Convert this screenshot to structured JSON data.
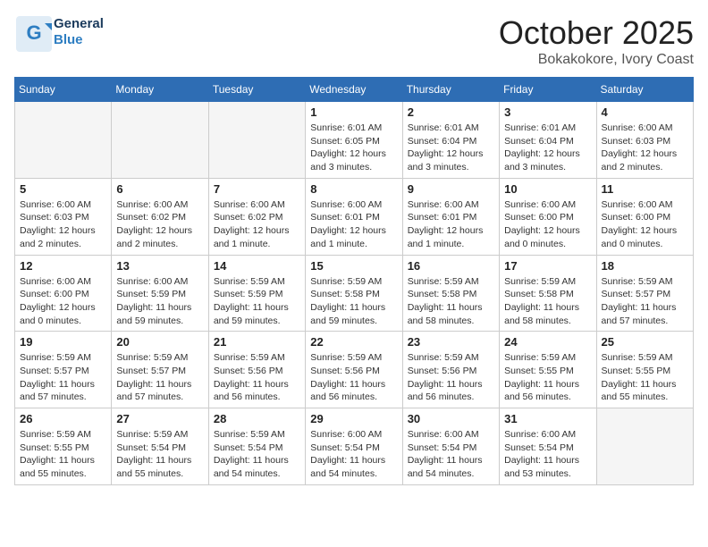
{
  "header": {
    "logo_general": "General",
    "logo_blue": "Blue",
    "title": "October 2025",
    "location": "Bokakokore, Ivory Coast"
  },
  "weekdays": [
    "Sunday",
    "Monday",
    "Tuesday",
    "Wednesday",
    "Thursday",
    "Friday",
    "Saturday"
  ],
  "weeks": [
    [
      {
        "num": "",
        "info": ""
      },
      {
        "num": "",
        "info": ""
      },
      {
        "num": "",
        "info": ""
      },
      {
        "num": "1",
        "info": "Sunrise: 6:01 AM\nSunset: 6:05 PM\nDaylight: 12 hours\nand 3 minutes."
      },
      {
        "num": "2",
        "info": "Sunrise: 6:01 AM\nSunset: 6:04 PM\nDaylight: 12 hours\nand 3 minutes."
      },
      {
        "num": "3",
        "info": "Sunrise: 6:01 AM\nSunset: 6:04 PM\nDaylight: 12 hours\nand 3 minutes."
      },
      {
        "num": "4",
        "info": "Sunrise: 6:00 AM\nSunset: 6:03 PM\nDaylight: 12 hours\nand 2 minutes."
      }
    ],
    [
      {
        "num": "5",
        "info": "Sunrise: 6:00 AM\nSunset: 6:03 PM\nDaylight: 12 hours\nand 2 minutes."
      },
      {
        "num": "6",
        "info": "Sunrise: 6:00 AM\nSunset: 6:02 PM\nDaylight: 12 hours\nand 2 minutes."
      },
      {
        "num": "7",
        "info": "Sunrise: 6:00 AM\nSunset: 6:02 PM\nDaylight: 12 hours\nand 1 minute."
      },
      {
        "num": "8",
        "info": "Sunrise: 6:00 AM\nSunset: 6:01 PM\nDaylight: 12 hours\nand 1 minute."
      },
      {
        "num": "9",
        "info": "Sunrise: 6:00 AM\nSunset: 6:01 PM\nDaylight: 12 hours\nand 1 minute."
      },
      {
        "num": "10",
        "info": "Sunrise: 6:00 AM\nSunset: 6:00 PM\nDaylight: 12 hours\nand 0 minutes."
      },
      {
        "num": "11",
        "info": "Sunrise: 6:00 AM\nSunset: 6:00 PM\nDaylight: 12 hours\nand 0 minutes."
      }
    ],
    [
      {
        "num": "12",
        "info": "Sunrise: 6:00 AM\nSunset: 6:00 PM\nDaylight: 12 hours\nand 0 minutes."
      },
      {
        "num": "13",
        "info": "Sunrise: 6:00 AM\nSunset: 5:59 PM\nDaylight: 11 hours\nand 59 minutes."
      },
      {
        "num": "14",
        "info": "Sunrise: 5:59 AM\nSunset: 5:59 PM\nDaylight: 11 hours\nand 59 minutes."
      },
      {
        "num": "15",
        "info": "Sunrise: 5:59 AM\nSunset: 5:58 PM\nDaylight: 11 hours\nand 59 minutes."
      },
      {
        "num": "16",
        "info": "Sunrise: 5:59 AM\nSunset: 5:58 PM\nDaylight: 11 hours\nand 58 minutes."
      },
      {
        "num": "17",
        "info": "Sunrise: 5:59 AM\nSunset: 5:58 PM\nDaylight: 11 hours\nand 58 minutes."
      },
      {
        "num": "18",
        "info": "Sunrise: 5:59 AM\nSunset: 5:57 PM\nDaylight: 11 hours\nand 57 minutes."
      }
    ],
    [
      {
        "num": "19",
        "info": "Sunrise: 5:59 AM\nSunset: 5:57 PM\nDaylight: 11 hours\nand 57 minutes."
      },
      {
        "num": "20",
        "info": "Sunrise: 5:59 AM\nSunset: 5:57 PM\nDaylight: 11 hours\nand 57 minutes."
      },
      {
        "num": "21",
        "info": "Sunrise: 5:59 AM\nSunset: 5:56 PM\nDaylight: 11 hours\nand 56 minutes."
      },
      {
        "num": "22",
        "info": "Sunrise: 5:59 AM\nSunset: 5:56 PM\nDaylight: 11 hours\nand 56 minutes."
      },
      {
        "num": "23",
        "info": "Sunrise: 5:59 AM\nSunset: 5:56 PM\nDaylight: 11 hours\nand 56 minutes."
      },
      {
        "num": "24",
        "info": "Sunrise: 5:59 AM\nSunset: 5:55 PM\nDaylight: 11 hours\nand 56 minutes."
      },
      {
        "num": "25",
        "info": "Sunrise: 5:59 AM\nSunset: 5:55 PM\nDaylight: 11 hours\nand 55 minutes."
      }
    ],
    [
      {
        "num": "26",
        "info": "Sunrise: 5:59 AM\nSunset: 5:55 PM\nDaylight: 11 hours\nand 55 minutes."
      },
      {
        "num": "27",
        "info": "Sunrise: 5:59 AM\nSunset: 5:54 PM\nDaylight: 11 hours\nand 55 minutes."
      },
      {
        "num": "28",
        "info": "Sunrise: 5:59 AM\nSunset: 5:54 PM\nDaylight: 11 hours\nand 54 minutes."
      },
      {
        "num": "29",
        "info": "Sunrise: 6:00 AM\nSunset: 5:54 PM\nDaylight: 11 hours\nand 54 minutes."
      },
      {
        "num": "30",
        "info": "Sunrise: 6:00 AM\nSunset: 5:54 PM\nDaylight: 11 hours\nand 54 minutes."
      },
      {
        "num": "31",
        "info": "Sunrise: 6:00 AM\nSunset: 5:54 PM\nDaylight: 11 hours\nand 53 minutes."
      },
      {
        "num": "",
        "info": ""
      }
    ]
  ]
}
